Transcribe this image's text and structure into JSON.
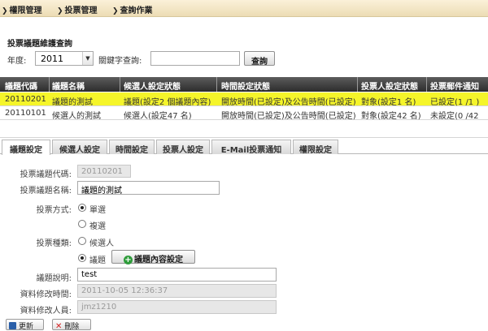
{
  "breadcrumb": [
    "權限管理",
    "投票管理",
    "查詢作業"
  ],
  "search": {
    "title": "投票議題維護查詢",
    "year_label": "年度:",
    "year_value": "2011",
    "keyword_label": "關鍵字查詢:",
    "keyword_value": "",
    "search_button": "查詢"
  },
  "table": {
    "headers": [
      "議題代碼",
      "議題名稱",
      "候選人設定狀態",
      "時間設定狀態",
      "投票人設定狀態",
      "投票郵件通知"
    ],
    "rows": [
      [
        "20110201",
        "議題的測試",
        "議題(設定2  個議題內容)",
        "開放時間(已設定)及公告時間(已設定)",
        "對象(設定1  名)",
        "已設定(1  /1  )"
      ],
      [
        "20110101",
        "候選人的測試",
        "候選人(設定47  名)",
        "開放時間(已設定)及公告時間(已設定)",
        "對象(設定42  名)",
        "未設定(0  /42"
      ]
    ]
  },
  "tabs": [
    "議題設定",
    "候選人設定",
    "時間設定",
    "投票人設定",
    "E-Mail投票通知",
    "權限設定"
  ],
  "form": {
    "code_label": "投票議題代碼:",
    "code_value": "20110201",
    "name_label": "投票議題名稱:",
    "name_value": "議題的測試",
    "method_label": "投票方式:",
    "method_options": [
      "單選",
      "複選"
    ],
    "type_label": "投票種類:",
    "type_options": [
      "候選人",
      "議題"
    ],
    "content_button": "議題內容設定",
    "desc_label": "議題說明:",
    "desc_value": "test",
    "modified_time_label": "資料修改時間:",
    "modified_time_value": "2011-10-05 12:36:37",
    "modified_by_label": "資料修改人員:",
    "modified_by_value": "jmz1210"
  },
  "footer": {
    "update_button": "更新",
    "delete_button": "刪除"
  },
  "colors": {
    "selected_row": "#f5f52a",
    "header_bg": "#3a3a3a",
    "topbar": "#f2e4c1",
    "add_icon": "#2e9c3a",
    "delete_icon": "#d42020",
    "save_icon": "#2a5fa8"
  }
}
